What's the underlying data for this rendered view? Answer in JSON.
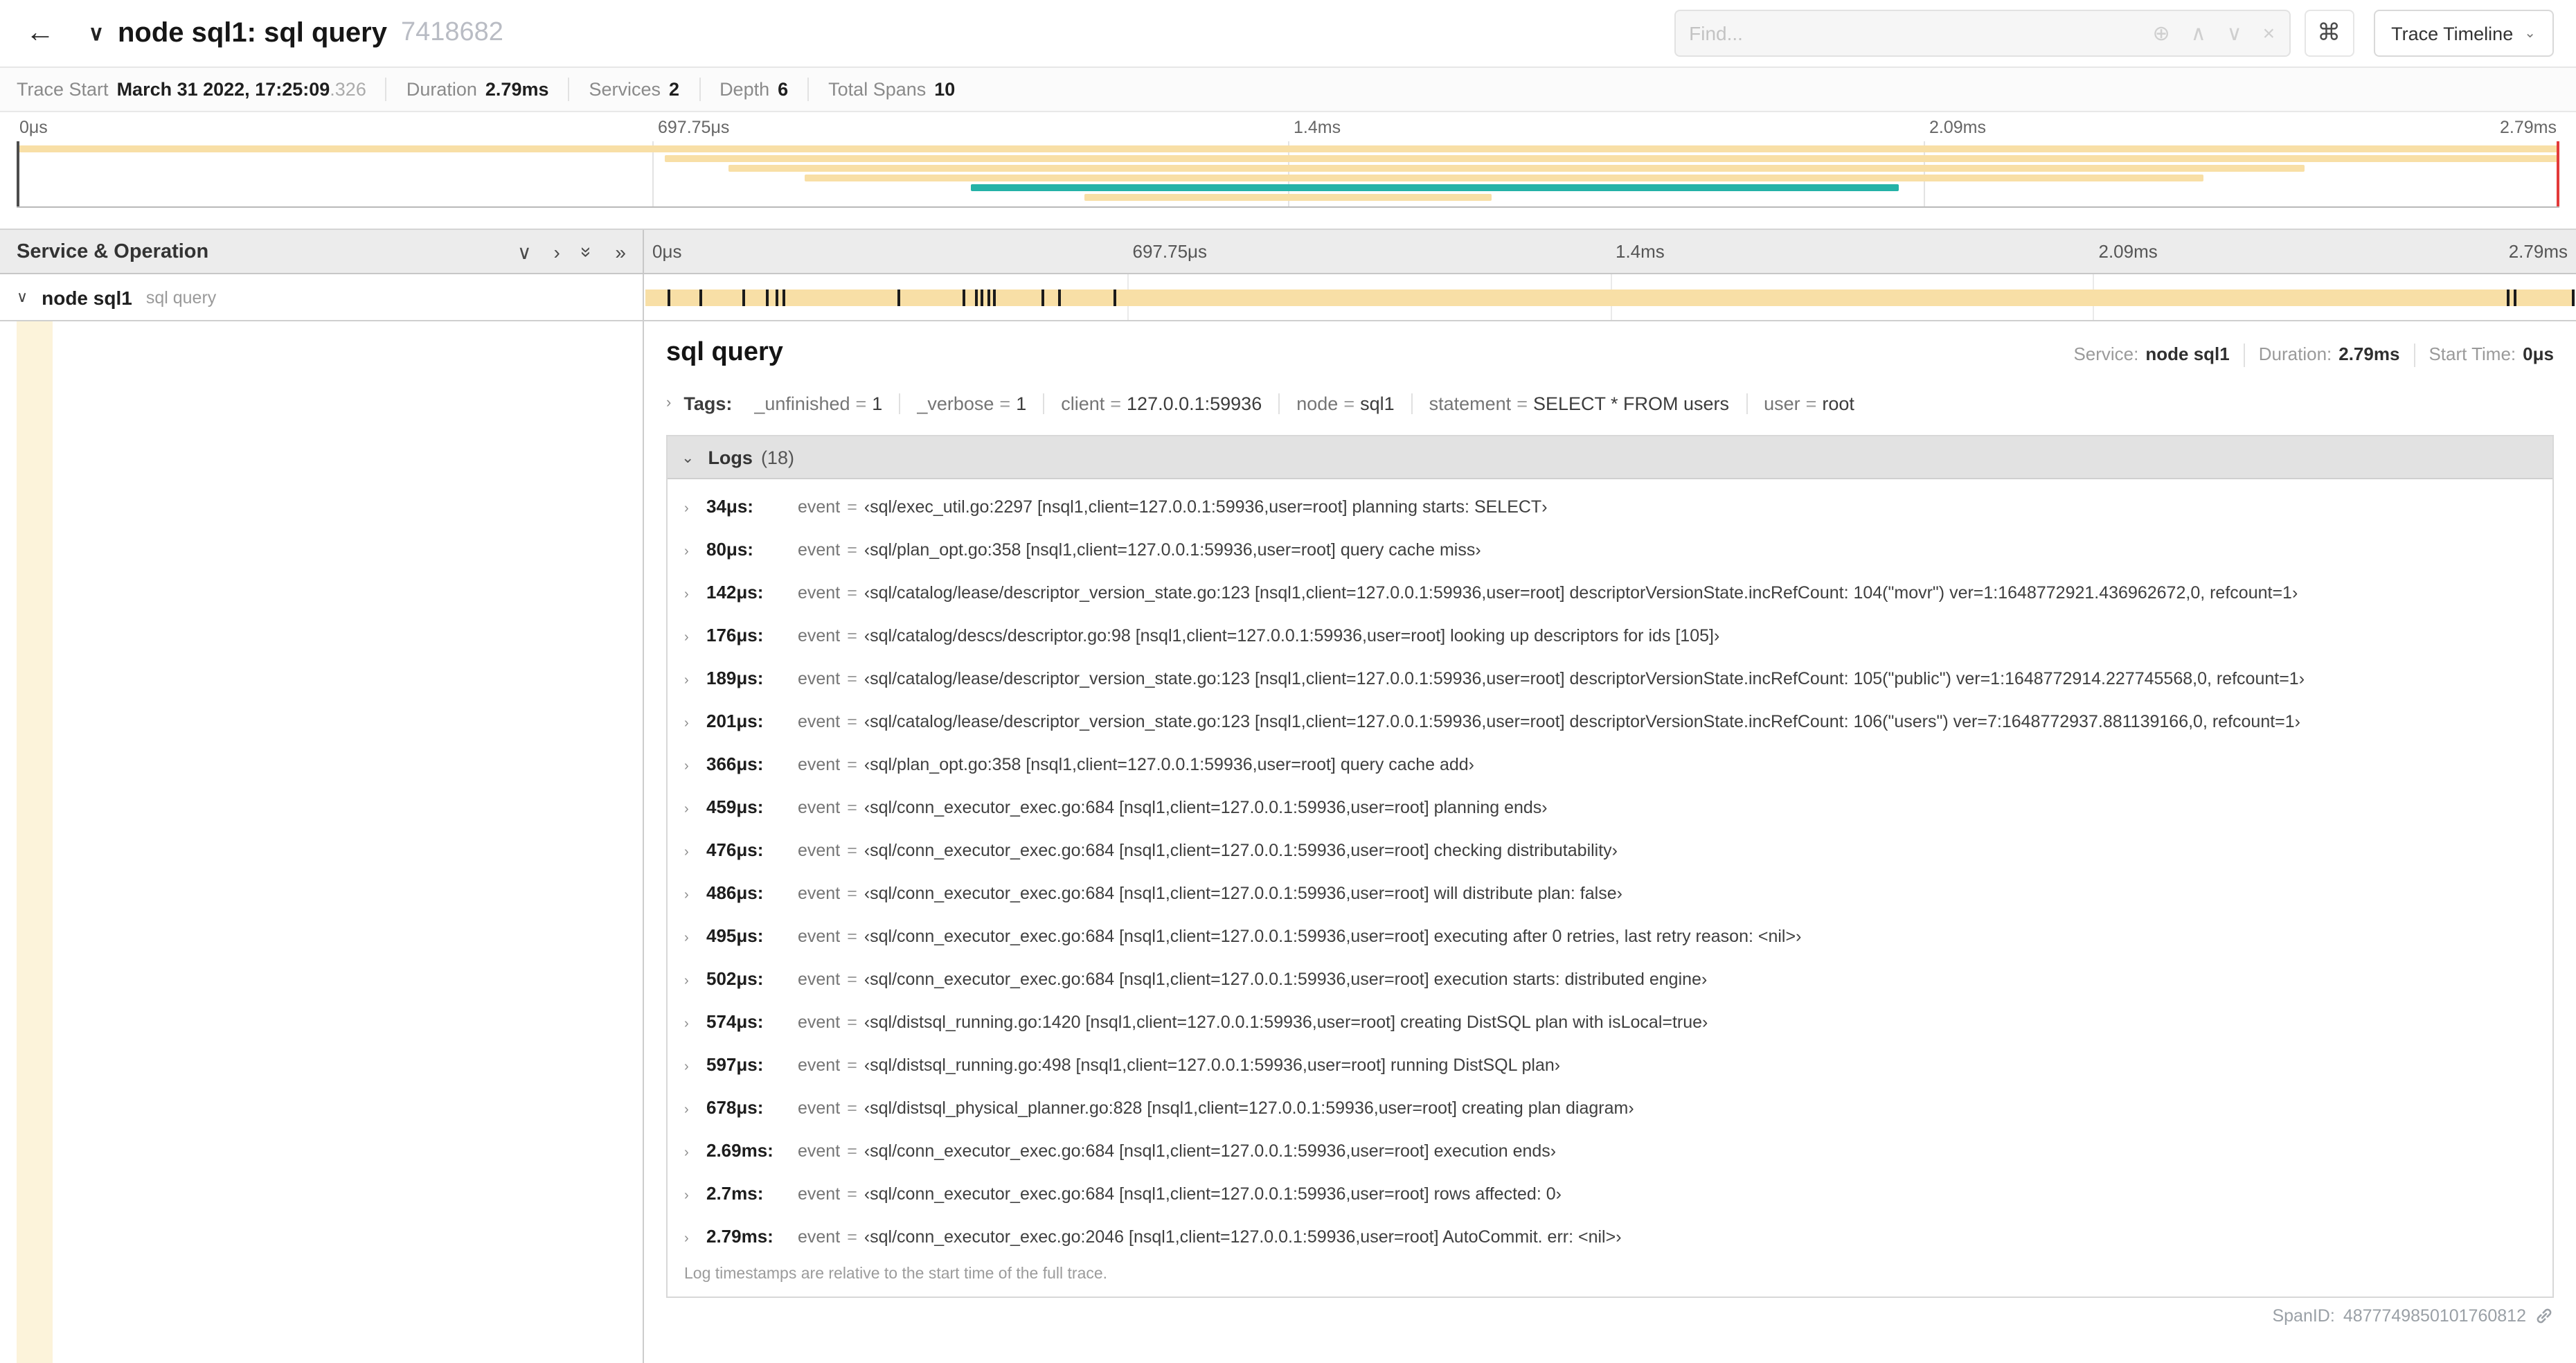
{
  "colors": {
    "span_bar": "#f8dfa6",
    "accent_bar": "#24b2a7",
    "cursor_line": "#e23a3a",
    "indent_strip": "#fcf3da"
  },
  "icons": {
    "back": "←",
    "title_collapse": "∨",
    "find_zoom": "⊕",
    "prev_match": "∧",
    "next_match": "∨",
    "clear_search": "×",
    "cmd": "⌘",
    "dropdown": "⌄",
    "collapse_one": "∨",
    "expand_one": "›",
    "double_chevron": "»",
    "row_collapse": "∨",
    "tags_expand": "›",
    "logs_collapse": "⌄",
    "log_expand": "›"
  },
  "misc": {
    "eq": "="
  },
  "header": {
    "title": "node sql1: sql query",
    "trace_id": "7418682",
    "find_placeholder": "Find...",
    "trace_timeline_label": "Trace Timeline"
  },
  "summary": {
    "items": [
      {
        "label": "Trace Start",
        "value": "March 31 2022, 17:25:09",
        "suffix": ".326"
      },
      {
        "label": "Duration",
        "value": "2.79ms"
      },
      {
        "label": "Services",
        "value": "2"
      },
      {
        "label": "Depth",
        "value": "6"
      },
      {
        "label": "Total Spans",
        "value": "10"
      }
    ]
  },
  "axis": {
    "ticks": [
      "0μs",
      "697.75μs",
      "1.4ms",
      "2.09ms",
      "2.79ms"
    ]
  },
  "minimap": {
    "bars": [
      {
        "t": 3,
        "l": 0,
        "w": 100,
        "c": "#f8dfa6"
      },
      {
        "t": 10,
        "l": 25.5,
        "w": 74.5,
        "c": "#f8dfa6"
      },
      {
        "t": 17,
        "l": 28,
        "w": 62,
        "c": "#f8dfa6"
      },
      {
        "t": 24,
        "l": 31,
        "w": 55,
        "c": "#f8dfa6"
      },
      {
        "t": 31,
        "l": 37.5,
        "w": 36.5,
        "c": "#24b2a7"
      },
      {
        "t": 38,
        "l": 42,
        "w": 16,
        "c": "#f8dfa6"
      }
    ]
  },
  "timeline": {
    "left_header": "Service & Operation",
    "row": {
      "service": "node sql1",
      "operation": "sql query"
    },
    "log_markers": [
      {
        "l": 1.2
      },
      {
        "l": 2.9
      },
      {
        "l": 5.1
      },
      {
        "l": 6.3
      },
      {
        "l": 6.8
      },
      {
        "l": 7.2
      },
      {
        "l": 13.1
      },
      {
        "l": 16.5
      },
      {
        "l": 17.1
      },
      {
        "l": 17.4
      },
      {
        "l": 17.8
      },
      {
        "l": 18.1
      },
      {
        "l": 20.6
      },
      {
        "l": 21.4
      },
      {
        "l": 24.3
      },
      {
        "l": 96.4
      },
      {
        "l": 96.8
      },
      {
        "l": 99.8
      }
    ]
  },
  "detail": {
    "title": "sql query",
    "meta": [
      {
        "label": "Service:",
        "value": "node sql1"
      },
      {
        "label": "Duration:",
        "value": "2.79ms"
      },
      {
        "label": "Start Time:",
        "value": "0μs"
      }
    ],
    "tags_label": "Tags:",
    "tags": [
      {
        "key": "_unfinished",
        "value": "1"
      },
      {
        "key": "_verbose",
        "value": "1"
      },
      {
        "key": "client",
        "value": "127.0.0.1:59936"
      },
      {
        "key": "node",
        "value": "sql1"
      },
      {
        "key": "statement",
        "value": "SELECT * FROM users"
      },
      {
        "key": "user",
        "value": "root"
      }
    ],
    "logs_label": "Logs",
    "logs_count": "(18)",
    "logs": [
      {
        "t": "34μs:",
        "k": "event",
        "v": "‹sql/exec_util.go:2297 [nsql1,client=127.0.0.1:59936,user=root] planning starts: SELECT›"
      },
      {
        "t": "80μs:",
        "k": "event",
        "v": "‹sql/plan_opt.go:358 [nsql1,client=127.0.0.1:59936,user=root] query cache miss›"
      },
      {
        "t": "142μs:",
        "k": "event",
        "v": "‹sql/catalog/lease/descriptor_version_state.go:123 [nsql1,client=127.0.0.1:59936,user=root] descriptorVersionState.incRefCount: 104(\"movr\") ver=1:1648772921.436962672,0, refcount=1›"
      },
      {
        "t": "176μs:",
        "k": "event",
        "v": "‹sql/catalog/descs/descriptor.go:98 [nsql1,client=127.0.0.1:59936,user=root] looking up descriptors for ids [105]›"
      },
      {
        "t": "189μs:",
        "k": "event",
        "v": "‹sql/catalog/lease/descriptor_version_state.go:123 [nsql1,client=127.0.0.1:59936,user=root] descriptorVersionState.incRefCount: 105(\"public\") ver=1:1648772914.227745568,0, refcount=1›"
      },
      {
        "t": "201μs:",
        "k": "event",
        "v": "‹sql/catalog/lease/descriptor_version_state.go:123 [nsql1,client=127.0.0.1:59936,user=root] descriptorVersionState.incRefCount: 106(\"users\") ver=7:1648772937.881139166,0, refcount=1›"
      },
      {
        "t": "366μs:",
        "k": "event",
        "v": "‹sql/plan_opt.go:358 [nsql1,client=127.0.0.1:59936,user=root] query cache add›"
      },
      {
        "t": "459μs:",
        "k": "event",
        "v": "‹sql/conn_executor_exec.go:684 [nsql1,client=127.0.0.1:59936,user=root] planning ends›"
      },
      {
        "t": "476μs:",
        "k": "event",
        "v": "‹sql/conn_executor_exec.go:684 [nsql1,client=127.0.0.1:59936,user=root] checking distributability›"
      },
      {
        "t": "486μs:",
        "k": "event",
        "v": "‹sql/conn_executor_exec.go:684 [nsql1,client=127.0.0.1:59936,user=root] will distribute plan: false›"
      },
      {
        "t": "495μs:",
        "k": "event",
        "v": "‹sql/conn_executor_exec.go:684 [nsql1,client=127.0.0.1:59936,user=root] executing after 0 retries, last retry reason: <nil>›"
      },
      {
        "t": "502μs:",
        "k": "event",
        "v": "‹sql/conn_executor_exec.go:684 [nsql1,client=127.0.0.1:59936,user=root] execution starts: distributed engine›"
      },
      {
        "t": "574μs:",
        "k": "event",
        "v": "‹sql/distsql_running.go:1420 [nsql1,client=127.0.0.1:59936,user=root] creating DistSQL plan with isLocal=true›"
      },
      {
        "t": "597μs:",
        "k": "event",
        "v": "‹sql/distsql_running.go:498 [nsql1,client=127.0.0.1:59936,user=root] running DistSQL plan›"
      },
      {
        "t": "678μs:",
        "k": "event",
        "v": "‹sql/distsql_physical_planner.go:828 [nsql1,client=127.0.0.1:59936,user=root] creating plan diagram›"
      },
      {
        "t": "2.69ms:",
        "k": "event",
        "v": "‹sql/conn_executor_exec.go:684 [nsql1,client=127.0.0.1:59936,user=root] execution ends›"
      },
      {
        "t": "2.7ms:",
        "k": "event",
        "v": "‹sql/conn_executor_exec.go:684 [nsql1,client=127.0.0.1:59936,user=root] rows affected: 0›"
      },
      {
        "t": "2.79ms:",
        "k": "event",
        "v": "‹sql/conn_executor_exec.go:2046 [nsql1,client=127.0.0.1:59936,user=root] AutoCommit. err: <nil>›"
      }
    ],
    "footnote": "Log timestamps are relative to the start time of the full trace.",
    "spanid_label": "SpanID:",
    "spanid": "4877749850101760812"
  }
}
